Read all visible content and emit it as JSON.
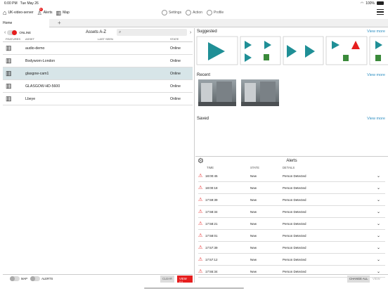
{
  "status": {
    "time": "6:00 PM",
    "date": "Tue May 26",
    "battery": "100%"
  },
  "nav": {
    "server": "UK-video-server",
    "alerts": "Alerts",
    "alerts_badge": "8",
    "map": "Map",
    "settings": "Settings",
    "action": "Action",
    "profile": "Profile"
  },
  "tabs": {
    "home": "Home",
    "add": "+"
  },
  "assets": {
    "online_label": "ONLINE",
    "title": "Assets A-Z",
    "columns": {
      "features": "FEATURES",
      "asset": "ASSET",
      "last_seen": "LAST SEEN",
      "state": "STATE"
    },
    "rows": [
      {
        "name": "audio-demo",
        "last_seen": "",
        "state": "Online"
      },
      {
        "name": "Bodyworn-London",
        "last_seen": "",
        "state": "Online"
      },
      {
        "name": "glasgow-cam1",
        "last_seen": "",
        "state": "Online"
      },
      {
        "name": "GLASGOW-HD-5600",
        "last_seen": "",
        "state": "Online"
      },
      {
        "name": "Lbeye",
        "last_seen": "",
        "state": "Online"
      }
    ],
    "map_toggle": "MAP",
    "alerts_toggle": "ALERTS",
    "clear": "CLEAR",
    "view": "VIEW (1)"
  },
  "right": {
    "suggested": "Suggested",
    "recent": "Recent",
    "saved": "Saved",
    "view_more": "View more"
  },
  "alerts": {
    "title": "Alerts",
    "columns": {
      "time": "TIME",
      "state": "STATE",
      "details": "DETAILS"
    },
    "rows": [
      {
        "time": "18:00:45",
        "state": "New",
        "details": "Person Detected"
      },
      {
        "time": "18:00:18",
        "state": "New",
        "details": "Person Detected"
      },
      {
        "time": "17:59:39",
        "state": "New",
        "details": "Person Detected"
      },
      {
        "time": "17:58:34",
        "state": "New",
        "details": "Person Detected"
      },
      {
        "time": "17:58:21",
        "state": "New",
        "details": "Person Detected"
      },
      {
        "time": "17:58:01",
        "state": "New",
        "details": "Person Detected"
      },
      {
        "time": "17:57:39",
        "state": "New",
        "details": "Person Detected"
      },
      {
        "time": "17:57:12",
        "state": "New",
        "details": "Person Detected"
      },
      {
        "time": "17:55:34",
        "state": "New",
        "details": "Person Detected"
      }
    ],
    "change_all": "CHANGE ALL",
    "view": "VIEW"
  },
  "colors": {
    "accent": "#2e8fc2",
    "teal": "#1f8f96",
    "red": "#e61e1e",
    "selected_row": "#d7e5e8"
  }
}
